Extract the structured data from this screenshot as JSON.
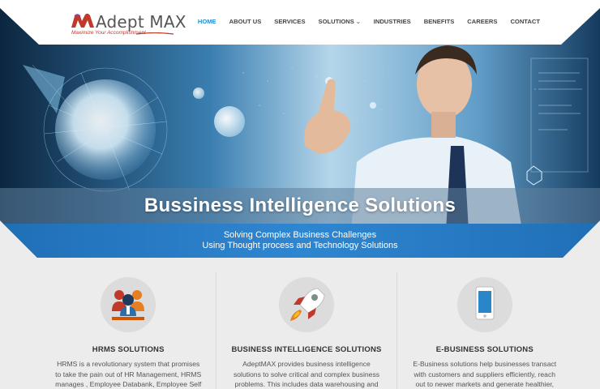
{
  "brand": {
    "name": "Adept MAX",
    "tagline": "Maximize Your Accomplishment"
  },
  "nav": {
    "items": [
      {
        "label": "HOME",
        "active": true
      },
      {
        "label": "ABOUT US"
      },
      {
        "label": "SERVICES"
      },
      {
        "label": "SOLUTIONS",
        "has_dropdown": true
      },
      {
        "label": "INDUSTRIES"
      },
      {
        "label": "BENEFITS"
      },
      {
        "label": "CAREERS"
      },
      {
        "label": "CONTACT"
      }
    ]
  },
  "banner": {
    "title": "Bussiness Intelligence Solutions",
    "subtitle_line1": "Solving Complex Business Challenges",
    "subtitle_line2": "Using Thought process and Technology Solutions"
  },
  "features": [
    {
      "title": "HRMS SOLUTIONS",
      "icon": "people-icon",
      "text": "HRMS is a revolutionary system that promises to take the pain out of HR Management, HRMS manages , Employee Databank, Employee Self"
    },
    {
      "title": "BUSINESS INTELLIGENCE SOLUTIONS",
      "icon": "rocket-icon",
      "text": "AdeptMAX provides business intelligence solutions to solve critical and complex business problems. This includes data warehousing and"
    },
    {
      "title": "E-BUSINESS SOLUTIONS",
      "icon": "smartphone-icon",
      "text": "E-Business solutions help businesses transact with customers and suppliers efficiently, reach out to newer markets and generate healthier, higher"
    }
  ],
  "colors": {
    "accent": "#2a8bd1",
    "banner_dark": "#0f2a45",
    "banner_light": "#7fc3ea",
    "background": "#ececec"
  }
}
